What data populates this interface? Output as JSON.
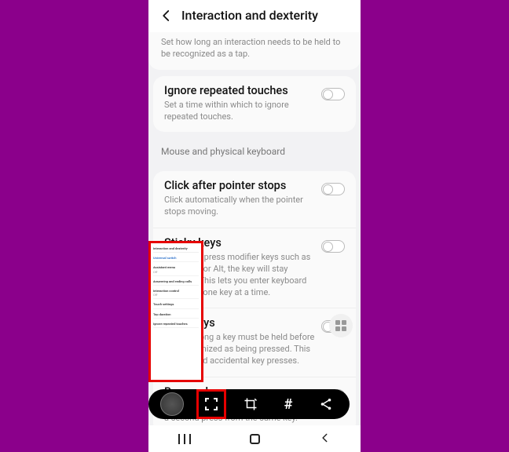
{
  "header": {
    "title": "Interaction and dexterity"
  },
  "tap_desc": "Set how long an interaction needs to be held to be recognized as a tap.",
  "settings": {
    "ignore_repeated": {
      "title": "Ignore repeated touches",
      "sub": "Set a time within which to ignore repeated touches."
    },
    "section_mouse": "Mouse and physical keyboard",
    "click_after": {
      "title": "Click after pointer stops",
      "sub": "Click automatically when the pointer stops moving."
    },
    "sticky": {
      "title": "Sticky keys",
      "sub": "When you press modifier keys such as Shift, Ctrl, or Alt, the key will stay pressed. This lets you enter keyboard shortcuts one key at a time."
    },
    "slow": {
      "title": "Slow keys",
      "sub": "Set how long a key must be held before it is recognized as being pressed. This helps avoid accidental key presses."
    },
    "bounce": {
      "title": "Bounce keys",
      "sub": "Set how long to wait before accepting a second press from the same key."
    }
  },
  "pill": {
    "hash": "#"
  }
}
